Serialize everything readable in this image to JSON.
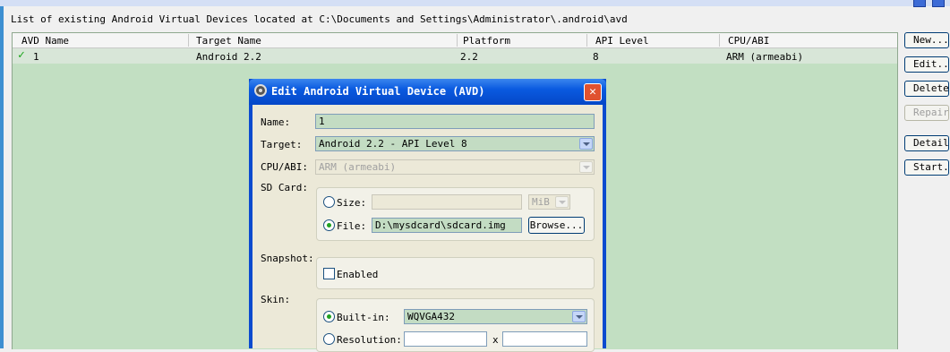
{
  "window": {
    "heading": "List of existing Android Virtual Devices located at C:\\Documents and Settings\\Administrator\\.android\\avd"
  },
  "table": {
    "columns": [
      "AVD Name",
      "Target Name",
      "Platform",
      "API Level",
      "CPU/ABI"
    ],
    "rows": [
      {
        "name": "1",
        "target": "Android 2.2",
        "platform": "2.2",
        "api": "8",
        "cpu": "ARM (armeabi)",
        "valid": true
      }
    ]
  },
  "buttons": {
    "new": "New...",
    "edit": "Edit...",
    "delete": "Delete...",
    "repair": "Repair...",
    "details": "Details...",
    "start": "Start..."
  },
  "dialog": {
    "title": "Edit Android Virtual Device (AVD)",
    "close_glyph": "✕",
    "name_label": "Name:",
    "name_value": "1",
    "target_label": "Target:",
    "target_value": "Android 2.2 - API Level 8",
    "cpu_label": "CPU/ABI:",
    "cpu_value": "ARM (armeabi)",
    "sdcard_label": "SD Card:",
    "size_label": "Size:",
    "size_value": "",
    "size_unit": "MiB",
    "file_label": "File:",
    "file_value": "D:\\mysdcard\\sdcard.img",
    "browse_label": "Browse...",
    "sdcard_selected": "file",
    "snapshot_label": "Snapshot:",
    "snapshot_enabled_label": "Enabled",
    "snapshot_enabled": false,
    "skin_label": "Skin:",
    "builtin_label": "Built-in:",
    "builtin_value": "WQVGA432",
    "resolution_label": "Resolution:",
    "resolution_x": "x",
    "skin_selected": "builtin"
  },
  "colors": {
    "table_bg": "#c2dfc2",
    "selected_row": "#d8e6d8",
    "titlebar": "#0a5ae0",
    "check": "#1aa51a"
  }
}
